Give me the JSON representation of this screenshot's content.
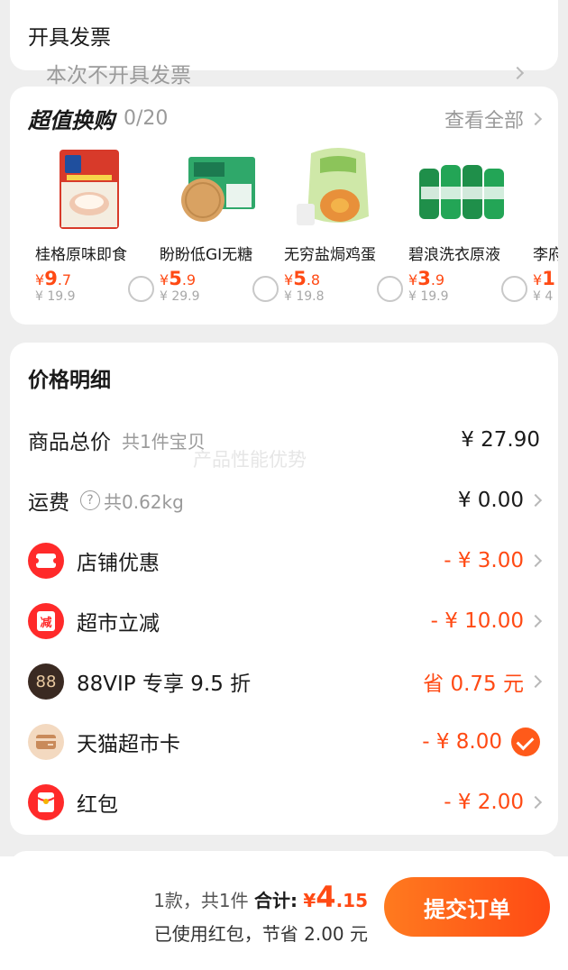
{
  "invoice": {
    "label": "开具发票",
    "value": "本次不开具发票"
  },
  "swap": {
    "title": "超值换购",
    "count": "0/20",
    "see_all": "查看全部",
    "products": [
      {
        "name": "桂格原味即食",
        "price_int": "9",
        "price_dec": ".7",
        "orig": "¥ 19.9"
      },
      {
        "name": "盼盼低GI无糖",
        "price_int": "5",
        "price_dec": ".9",
        "orig": "¥ 29.9"
      },
      {
        "name": "无穷盐焗鸡蛋",
        "price_int": "5",
        "price_dec": ".8",
        "orig": "¥ 19.8"
      },
      {
        "name": "碧浪洗衣原液",
        "price_int": "3",
        "price_dec": ".9",
        "orig": "¥ 19.9"
      },
      {
        "name": "李府",
        "price_int": "1",
        "price_dec": "",
        "orig": "¥ 4"
      }
    ]
  },
  "detail": {
    "title": "价格明细",
    "total_label": "商品总价",
    "total_sub": "共1件宝贝",
    "total_value": "¥ 27.90",
    "freight_label": "运费",
    "freight_sub": "共0.62kg",
    "freight_value": "¥ 0.00",
    "store_label": "店铺优惠",
    "store_value": "- ¥ 3.00",
    "market_label": "超市立减",
    "market_icon_text": "减",
    "market_value": "- ¥ 10.00",
    "vip_label": "88VIP 专享 9.5 折",
    "vip_icon_text": "88",
    "vip_value": "省 0.75 元",
    "card_label": "天猫超市卡",
    "card_value": "- ¥ 8.00",
    "hongbao_label": "红包",
    "hongbao_value": "- ¥ 2.00"
  },
  "watermark": "产品性能优势",
  "bottom": {
    "count_text": "1款，共1件",
    "total_label": "合计:",
    "currency": "¥",
    "total_int": "4",
    "total_dec": ".15",
    "saved_text": "已使用红包，节省 2.00 元",
    "submit_label": "提交订单"
  },
  "colors": {
    "accent": "#ff4a14",
    "muted": "#9a9a9a"
  }
}
